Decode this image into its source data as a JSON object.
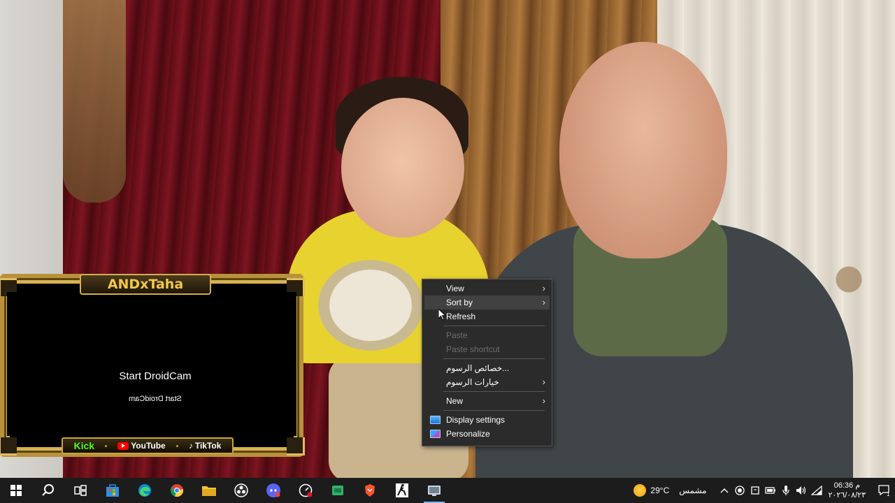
{
  "droidcam": {
    "title": "ANDxTaha",
    "start_text": "Start DroidCam",
    "start_text_mirrored": "Start DroidCam",
    "socials": {
      "kick": "Kick",
      "youtube": "YouTube",
      "tiktok": "TikTok"
    }
  },
  "context_menu": {
    "items": [
      {
        "label": "View",
        "submenu": true,
        "disabled": false
      },
      {
        "label": "Sort by",
        "submenu": true,
        "disabled": false,
        "hovered": true
      },
      {
        "label": "Refresh",
        "submenu": false,
        "disabled": false
      },
      {
        "label": "Paste",
        "submenu": false,
        "disabled": true
      },
      {
        "label": "Paste shortcut",
        "submenu": false,
        "disabled": true
      },
      {
        "label": "خصائص الرسوم...",
        "submenu": false,
        "disabled": false
      },
      {
        "label": "خيارات الرسوم",
        "submenu": true,
        "disabled": false
      },
      {
        "label": "New",
        "submenu": true,
        "disabled": false
      },
      {
        "label": "Display settings",
        "submenu": false,
        "disabled": false,
        "icon": "display-icon"
      },
      {
        "label": "Personalize",
        "submenu": false,
        "disabled": false,
        "icon": "personalize-icon"
      }
    ]
  },
  "taskbar": {
    "apps": [
      "start-icon",
      "search-icon",
      "task-view-icon",
      "microsoft-store-icon",
      "edge-icon",
      "chrome-icon",
      "file-explorer-icon",
      "obs-icon",
      "discord-icon",
      "speedtest-icon",
      "android-icon",
      "brave-icon",
      "app-icon",
      "droidcam-icon"
    ],
    "weather": {
      "temp": "29°C",
      "condition": "مشمس"
    },
    "clock": {
      "time": "06:36 م",
      "date": "٢٠٢٦/٠٨/٢٣"
    },
    "notification_count": "1"
  },
  "colors": {
    "menu_bg": "#2b2b2b",
    "menu_hover": "#414141",
    "taskbar_bg": "#1c1c1c",
    "accent_gold": "#d4ae50"
  }
}
